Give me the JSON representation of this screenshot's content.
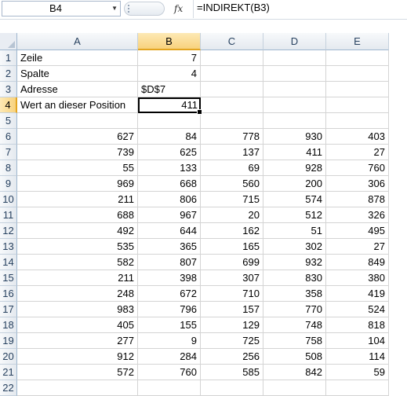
{
  "formula_bar": {
    "name_box": "B4",
    "fx_label": "fx",
    "formula": "=INDIREKT(B3)"
  },
  "columns": [
    "A",
    "B",
    "C",
    "D",
    "E"
  ],
  "selected_column": "B",
  "selected_row": 4,
  "active_cell": "B4",
  "rows": [
    {
      "num": 1,
      "cells": [
        "Zeile",
        "7",
        "",
        "",
        ""
      ]
    },
    {
      "num": 2,
      "cells": [
        "Spalte",
        "4",
        "",
        "",
        ""
      ]
    },
    {
      "num": 3,
      "cells": [
        "Adresse",
        "$D$7",
        "",
        "",
        ""
      ]
    },
    {
      "num": 4,
      "cells": [
        "Wert an dieser Position",
        "411",
        "",
        "",
        ""
      ]
    },
    {
      "num": 5,
      "cells": [
        "",
        "",
        "",
        "",
        ""
      ]
    },
    {
      "num": 6,
      "cells": [
        "627",
        "84",
        "778",
        "930",
        "403"
      ]
    },
    {
      "num": 7,
      "cells": [
        "739",
        "625",
        "137",
        "411",
        "27"
      ]
    },
    {
      "num": 8,
      "cells": [
        "55",
        "133",
        "69",
        "928",
        "760"
      ]
    },
    {
      "num": 9,
      "cells": [
        "969",
        "668",
        "560",
        "200",
        "306"
      ]
    },
    {
      "num": 10,
      "cells": [
        "211",
        "806",
        "715",
        "574",
        "878"
      ]
    },
    {
      "num": 11,
      "cells": [
        "688",
        "967",
        "20",
        "512",
        "326"
      ]
    },
    {
      "num": 12,
      "cells": [
        "492",
        "644",
        "162",
        "51",
        "495"
      ]
    },
    {
      "num": 13,
      "cells": [
        "535",
        "365",
        "165",
        "302",
        "27"
      ]
    },
    {
      "num": 14,
      "cells": [
        "582",
        "807",
        "699",
        "932",
        "849"
      ]
    },
    {
      "num": 15,
      "cells": [
        "211",
        "398",
        "307",
        "830",
        "380"
      ]
    },
    {
      "num": 16,
      "cells": [
        "248",
        "672",
        "710",
        "358",
        "419"
      ]
    },
    {
      "num": 17,
      "cells": [
        "983",
        "796",
        "157",
        "770",
        "524"
      ]
    },
    {
      "num": 18,
      "cells": [
        "405",
        "155",
        "129",
        "748",
        "818"
      ]
    },
    {
      "num": 19,
      "cells": [
        "277",
        "9",
        "725",
        "758",
        "104"
      ]
    },
    {
      "num": 20,
      "cells": [
        "912",
        "284",
        "256",
        "508",
        "114"
      ]
    },
    {
      "num": 21,
      "cells": [
        "572",
        "760",
        "585",
        "842",
        "59"
      ]
    },
    {
      "num": 22,
      "cells": [
        "",
        "",
        "",
        "",
        ""
      ]
    }
  ]
}
